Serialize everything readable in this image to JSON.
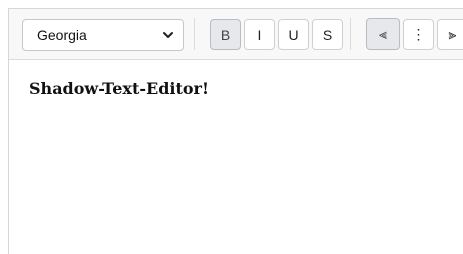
{
  "toolbar": {
    "font_select": {
      "value": "Georgia",
      "icon": "chevron-down-icon"
    },
    "format_buttons": [
      {
        "label": "B",
        "name": "bold-button",
        "active": true
      },
      {
        "label": "I",
        "name": "italic-button",
        "active": false
      },
      {
        "label": "U",
        "name": "underline-button",
        "active": false
      },
      {
        "label": "S",
        "name": "strikethrough-button",
        "active": false
      }
    ],
    "align_buttons": [
      {
        "icon": "align-left-icon",
        "glyph": "⫷",
        "active": true
      },
      {
        "icon": "align-center-icon",
        "glyph": "⋮",
        "active": false
      },
      {
        "icon": "align-right-icon",
        "glyph": "⫸",
        "active": false
      }
    ]
  },
  "editor": {
    "content": "Shadow-Text-Editor!"
  }
}
